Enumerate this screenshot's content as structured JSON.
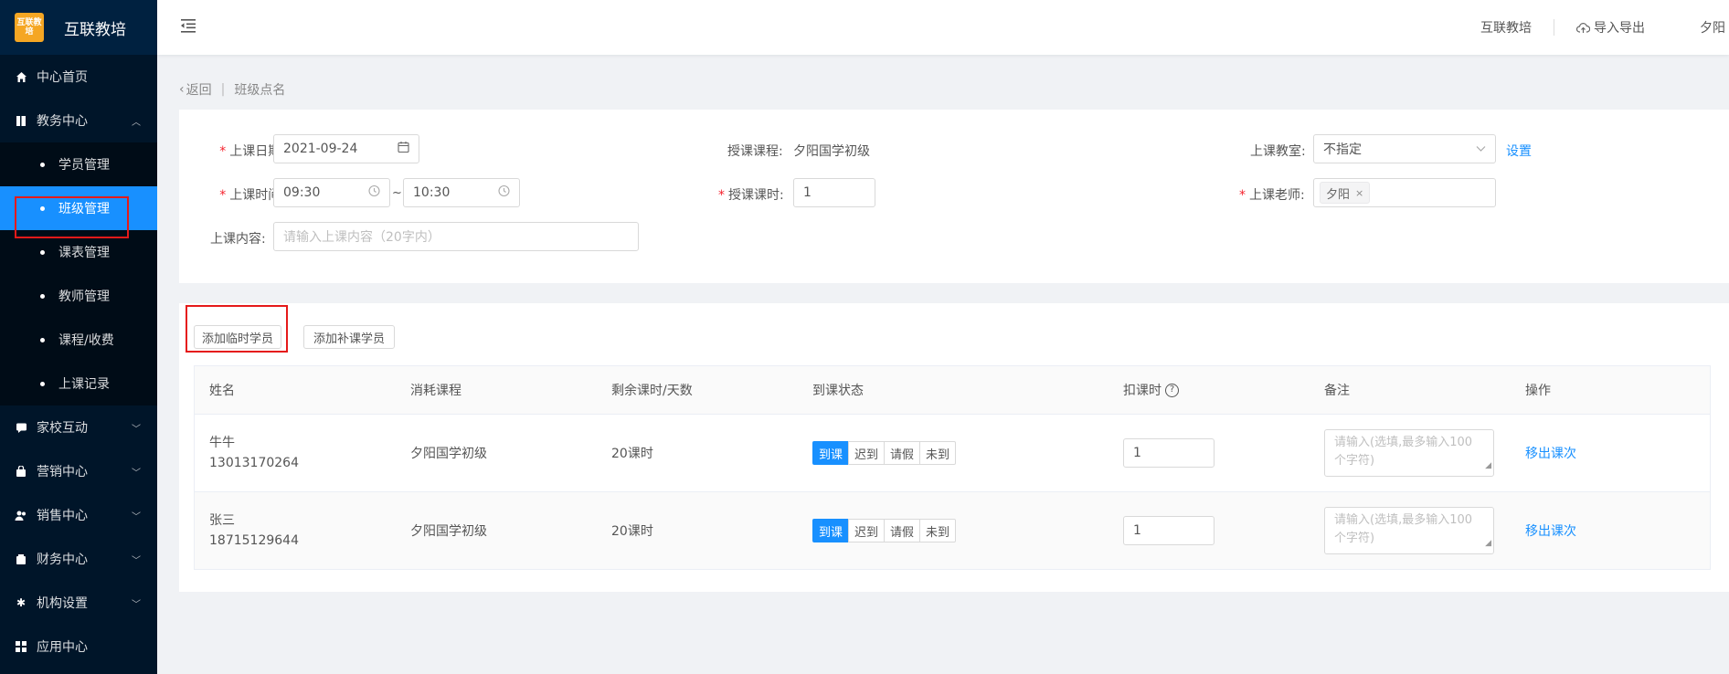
{
  "app": {
    "logo_text": "互联教培",
    "logo_mark": "互联教培"
  },
  "sidebar": {
    "items": [
      {
        "label": "中心首页",
        "icon": "home-icon"
      },
      {
        "label": "教务中心",
        "icon": "book-icon",
        "expanded": true
      },
      {
        "label": "家校互动",
        "icon": "chat-icon"
      },
      {
        "label": "营销中心",
        "icon": "bag-icon"
      },
      {
        "label": "销售中心",
        "icon": "users-icon"
      },
      {
        "label": "财务中心",
        "icon": "wallet-icon"
      },
      {
        "label": "机构设置",
        "icon": "gear-icon"
      },
      {
        "label": "应用中心",
        "icon": "grid-icon"
      }
    ],
    "sub_items": [
      "学员管理",
      "班级管理",
      "课表管理",
      "教师管理",
      "课程/收费",
      "上课记录"
    ],
    "active_sub": "班级管理"
  },
  "header": {
    "org_link": "互联教培",
    "export_label": "导入导出",
    "user_name": "夕阳"
  },
  "breadcrumb": {
    "back": "返回",
    "separator": "|",
    "current": "班级点名"
  },
  "form": {
    "date_label": "上课日期:",
    "date_value": "2021-09-24",
    "course_label": "授课课程:",
    "course_value": "夕阳国学初级",
    "room_label": "上课教室:",
    "room_value": "不指定",
    "room_setting": "设置",
    "time_label": "上课时间:",
    "time_start": "09:30",
    "time_sep": "~",
    "time_end": "10:30",
    "hours_label": "授课课时:",
    "hours_value": "1",
    "teacher_label": "上课老师:",
    "teacher_tag": "夕阳",
    "content_label": "上课内容:",
    "content_placeholder": "请输入上课内容（20字内）"
  },
  "actions": {
    "add_temp": "添加临时学员",
    "add_makeup": "添加补课学员"
  },
  "table": {
    "columns": [
      "姓名",
      "消耗课程",
      "剩余课时/天数",
      "到课状态",
      "扣课时",
      "备注",
      "操作"
    ],
    "status_options": [
      "到课",
      "迟到",
      "请假",
      "未到"
    ],
    "rows": [
      {
        "name": "牛牛",
        "phone": "13013170264",
        "course": "夕阳国学初级",
        "remaining": "20课时",
        "status": "到课",
        "deduct": "1",
        "note_placeholder": "请输入(选填,最多输入100个字符)",
        "action": "移出课次"
      },
      {
        "name": "张三",
        "phone": "18715129644",
        "course": "夕阳国学初级",
        "remaining": "20课时",
        "status": "到课",
        "deduct": "1",
        "note_placeholder": "请输入(选填,最多输入100个字符)",
        "action": "移出课次"
      }
    ]
  },
  "colors": {
    "sidebar_bg": "#001529",
    "accent": "#1890ff",
    "required": "#f5222d",
    "highlight_box": "#e51a1a"
  }
}
